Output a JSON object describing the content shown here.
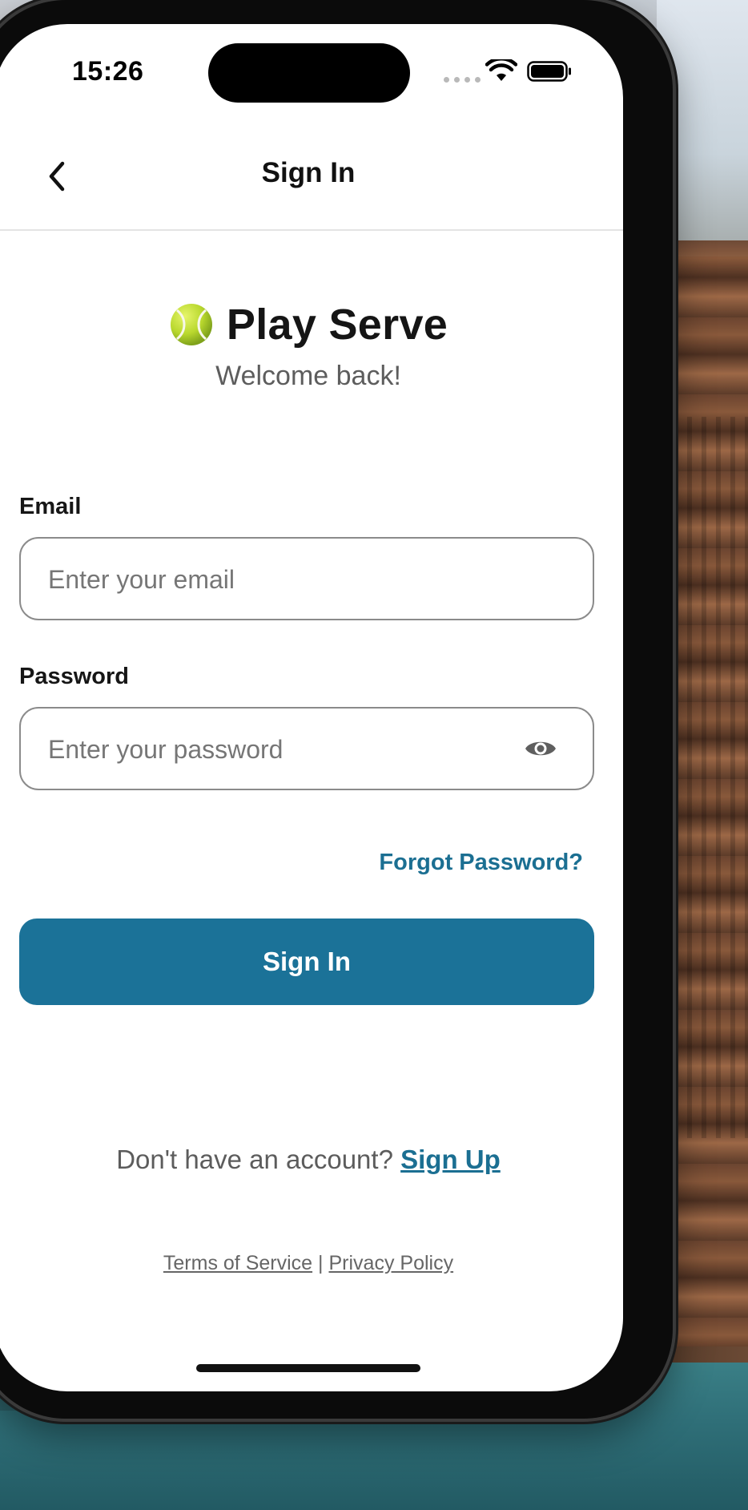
{
  "status_bar": {
    "time": "15:26"
  },
  "nav": {
    "title": "Sign In"
  },
  "brand": {
    "emoji": "🎾",
    "name": "Play Serve",
    "subtitle": "Welcome back!"
  },
  "form": {
    "email": {
      "label": "Email",
      "placeholder": "Enter your email",
      "value": ""
    },
    "password": {
      "label": "Password",
      "placeholder": "Enter your password",
      "value": ""
    },
    "forgot_label": "Forgot Password?",
    "submit_label": "Sign In"
  },
  "signup": {
    "prompt": "Don't have an account?",
    "link": "Sign Up"
  },
  "legal": {
    "terms": "Terms of Service",
    "separator": "|",
    "privacy": "Privacy Policy"
  },
  "icons": {
    "back": "chevron-left-icon",
    "password_toggle": "eye-icon",
    "wifi": "wifi-icon",
    "battery": "battery-icon"
  },
  "colors": {
    "accent": "#1b7298",
    "link": "#1b6f92",
    "text_primary": "#151515",
    "text_secondary": "#5d5d5d",
    "input_border": "#8b8b8b"
  }
}
